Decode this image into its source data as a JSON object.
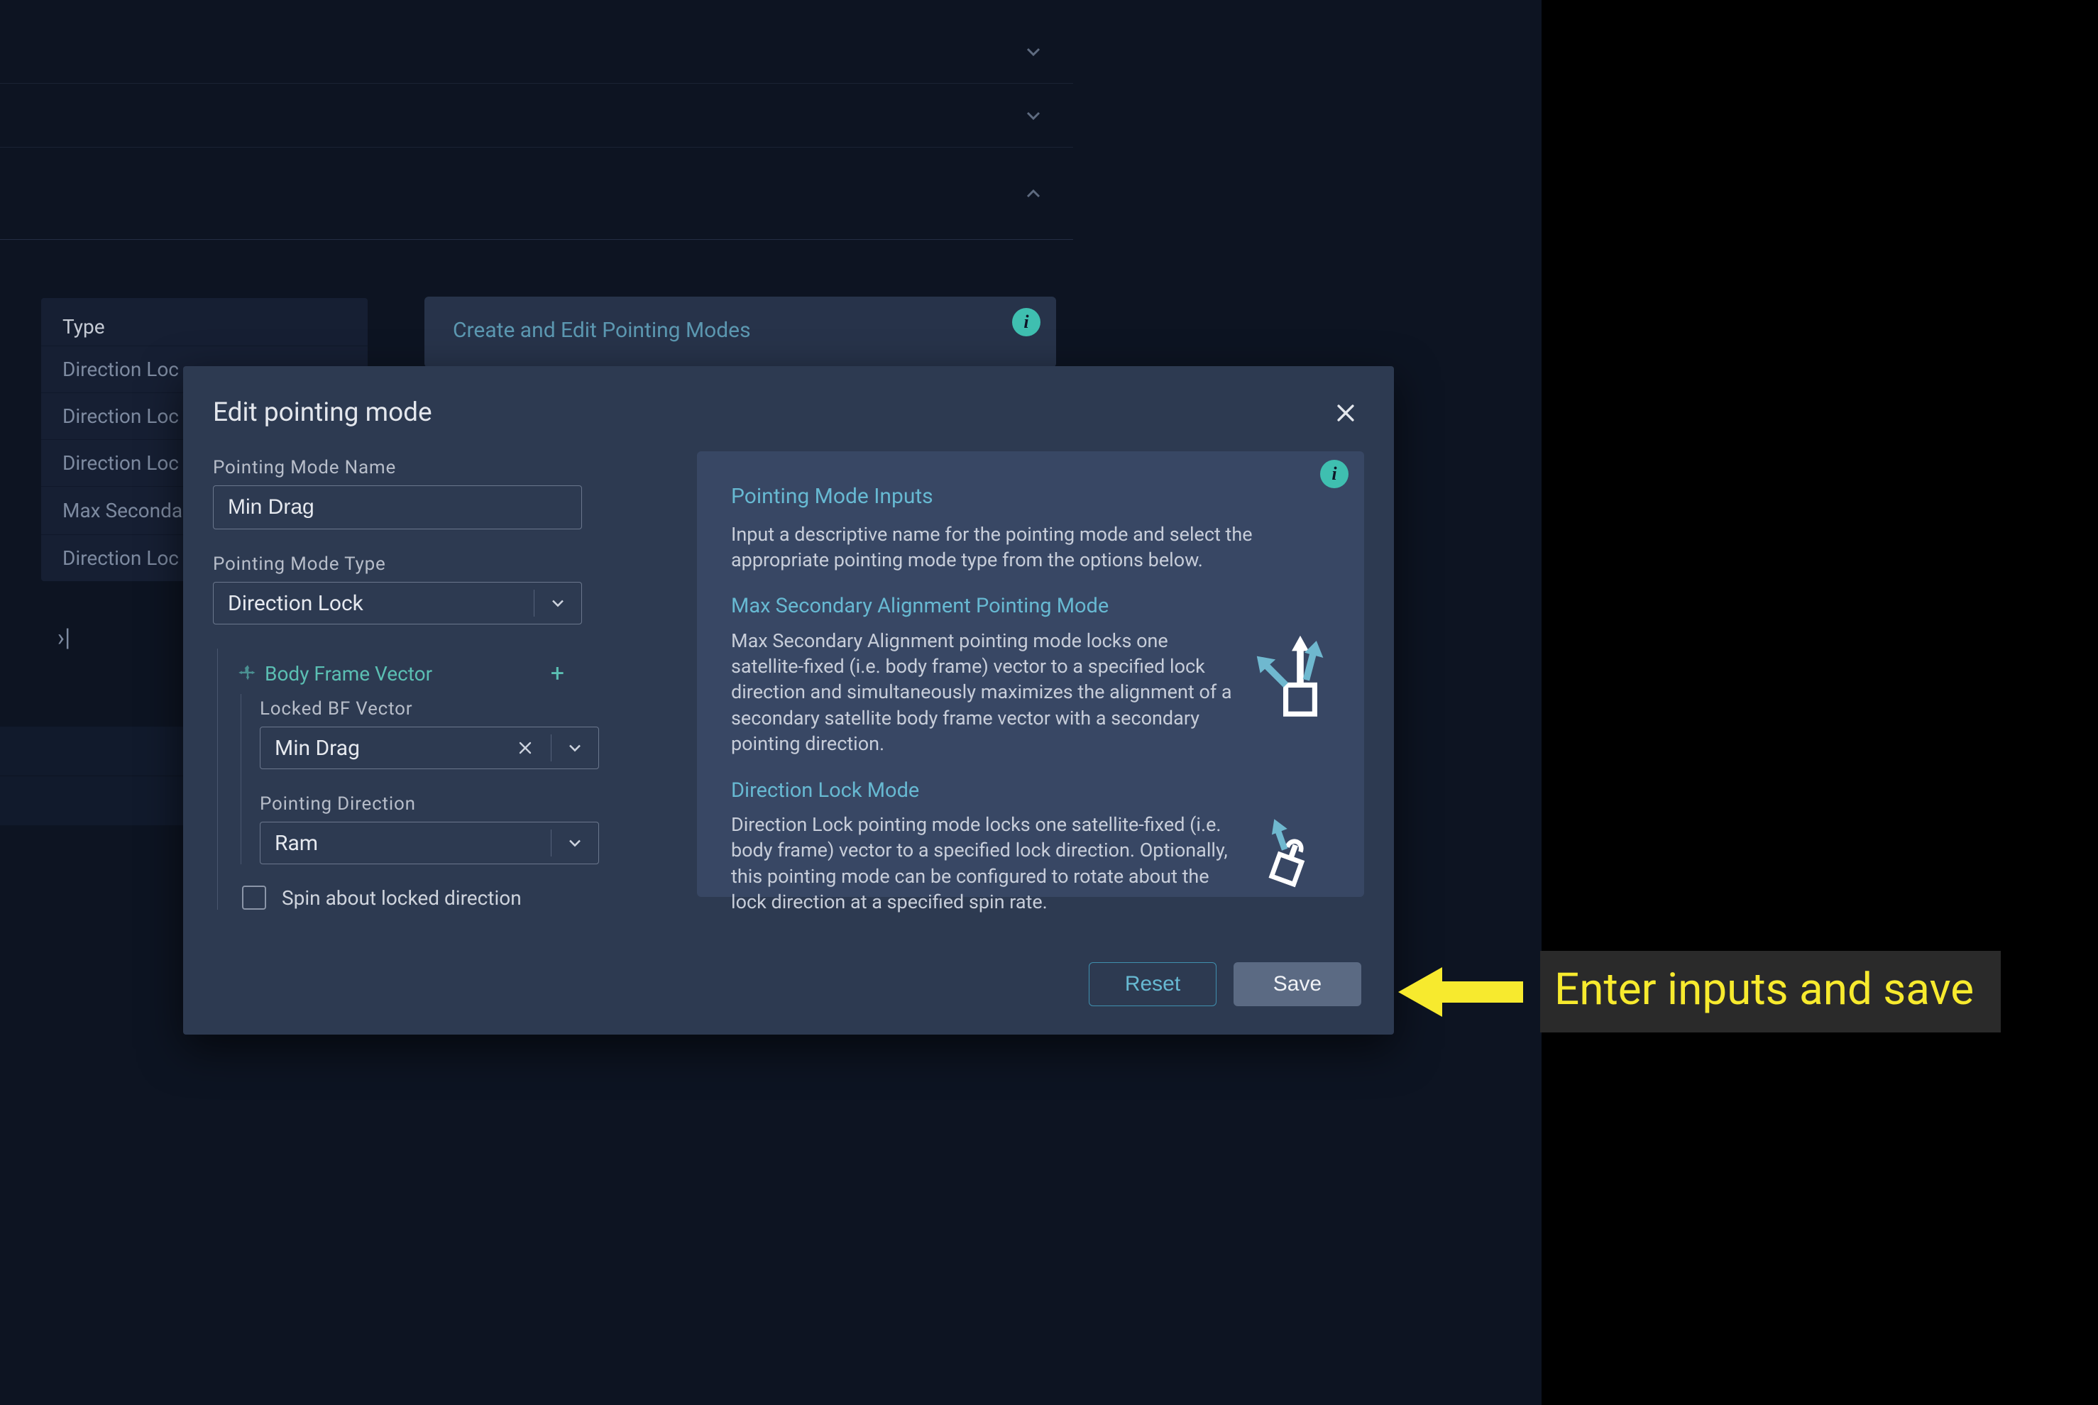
{
  "bg": {
    "type_header": "Type",
    "type_rows": [
      "Direction Loc",
      "Direction Loc",
      "Direction Loc",
      "Max Secondary Alignment",
      "Direction Loc"
    ],
    "info_title": "Create and Edit Pointing Modes"
  },
  "dialog": {
    "title": "Edit pointing mode",
    "fields": {
      "name_label": "Pointing Mode Name",
      "name_value": "Min Drag",
      "type_label": "Pointing Mode Type",
      "type_value": "Direction Lock",
      "bfv_header": "Body Frame Vector",
      "locked_bf_label": "Locked BF Vector",
      "locked_bf_value": "Min Drag",
      "pointing_dir_label": "Pointing Direction",
      "pointing_dir_value": "Ram",
      "spin_label": "Spin about locked direction"
    },
    "info": {
      "h1": "Pointing Mode Inputs",
      "p1": "Input a descriptive name for the pointing mode and select the appropriate pointing mode type from the options below.",
      "h2": "Max Secondary Alignment Pointing Mode",
      "p2": "Max Secondary Alignment pointing mode locks one satellite-fixed (i.e. body frame) vector to a specified lock direction and simultaneously maximizes the alignment of a secondary satellite body frame vector with a secondary pointing direction.",
      "h3": "Direction Lock Mode",
      "p3": "Direction Lock pointing mode locks one satellite-fixed (i.e. body frame) vector to a specified lock direction. Optionally, this pointing mode can be configured to rotate about the lock direction at a specified spin rate."
    },
    "actions": {
      "reset": "Reset",
      "save": "Save"
    }
  },
  "callout": {
    "text": "Enter inputs and save"
  }
}
